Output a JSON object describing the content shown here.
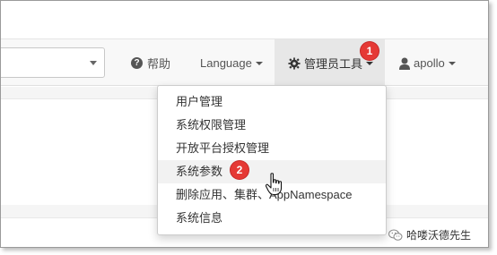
{
  "navbar": {
    "help_label": "帮助",
    "language_label": "Language",
    "admin_tools_label": "管理员工具",
    "user_label": "apollo"
  },
  "admin_menu": {
    "items": [
      {
        "label": "用户管理"
      },
      {
        "label": "系统权限管理"
      },
      {
        "label": "开放平台授权管理"
      },
      {
        "label": "系统参数"
      },
      {
        "label": "删除应用、集群、AppNamespace"
      },
      {
        "label": "系统信息"
      }
    ],
    "hovered_index": 3
  },
  "annotations": {
    "step1": "1",
    "step2": "2"
  },
  "watermark": {
    "text": "哈喽沃德先生"
  },
  "colors": {
    "badge": "#e53935",
    "navbar_bg": "#f8f8f8",
    "active_nav_bg": "#e7e7e7"
  },
  "icons": {
    "help": "question-circle-icon",
    "admin": "gear-icon",
    "user": "user-icon",
    "cursor": "hand-pointer-icon",
    "watermark": "wechat-icon"
  }
}
